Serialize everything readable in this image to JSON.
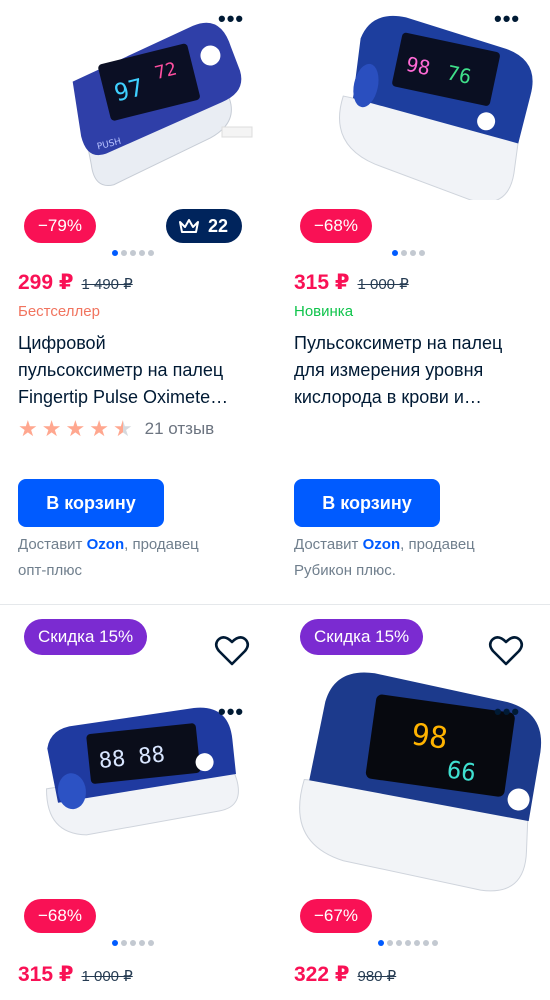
{
  "products": [
    {
      "discount": "−79%",
      "crown_count": "22",
      "price": "299 ₽",
      "old_price": "1 490 ₽",
      "label": "Бестселлер",
      "title_lines": [
        "Цифровой",
        "пульсоксиметр на палец",
        "Fingertip Pulse Oximete…"
      ],
      "rating": 4.5,
      "reviews": "21 отзыв",
      "cart_button": "В корзину",
      "delivery_prefix": "Доставит ",
      "delivery_brand": "Ozon",
      "delivery_suffix": ", продавец",
      "seller": "опт-плюс"
    },
    {
      "discount": "−68%",
      "price": "315 ₽",
      "old_price": "1 000 ₽",
      "label": "Новинка",
      "title_lines": [
        "Пульсоксиметр на палец",
        "для измерения уровня",
        "кислорода в крови и…"
      ],
      "cart_button": "В корзину",
      "delivery_prefix": "Доставит ",
      "delivery_brand": "Ozon",
      "delivery_suffix": ", продавец",
      "seller": "Рубикон плюс."
    },
    {
      "promo": "Скидка 15%",
      "discount": "−68%",
      "price": "315 ₽",
      "old_price": "1 000 ₽"
    },
    {
      "promo": "Скидка 15%",
      "discount": "−67%",
      "price": "322 ₽",
      "old_price": "980 ₽"
    }
  ],
  "icons": {
    "more": "more-dots-icon",
    "crown": "crown-icon",
    "heart": "heart-icon",
    "star": "star-icon"
  },
  "colors": {
    "accent": "#005bff",
    "discount": "#f91155",
    "promo": "#7b2bd1",
    "crown_badge": "#00245c"
  }
}
